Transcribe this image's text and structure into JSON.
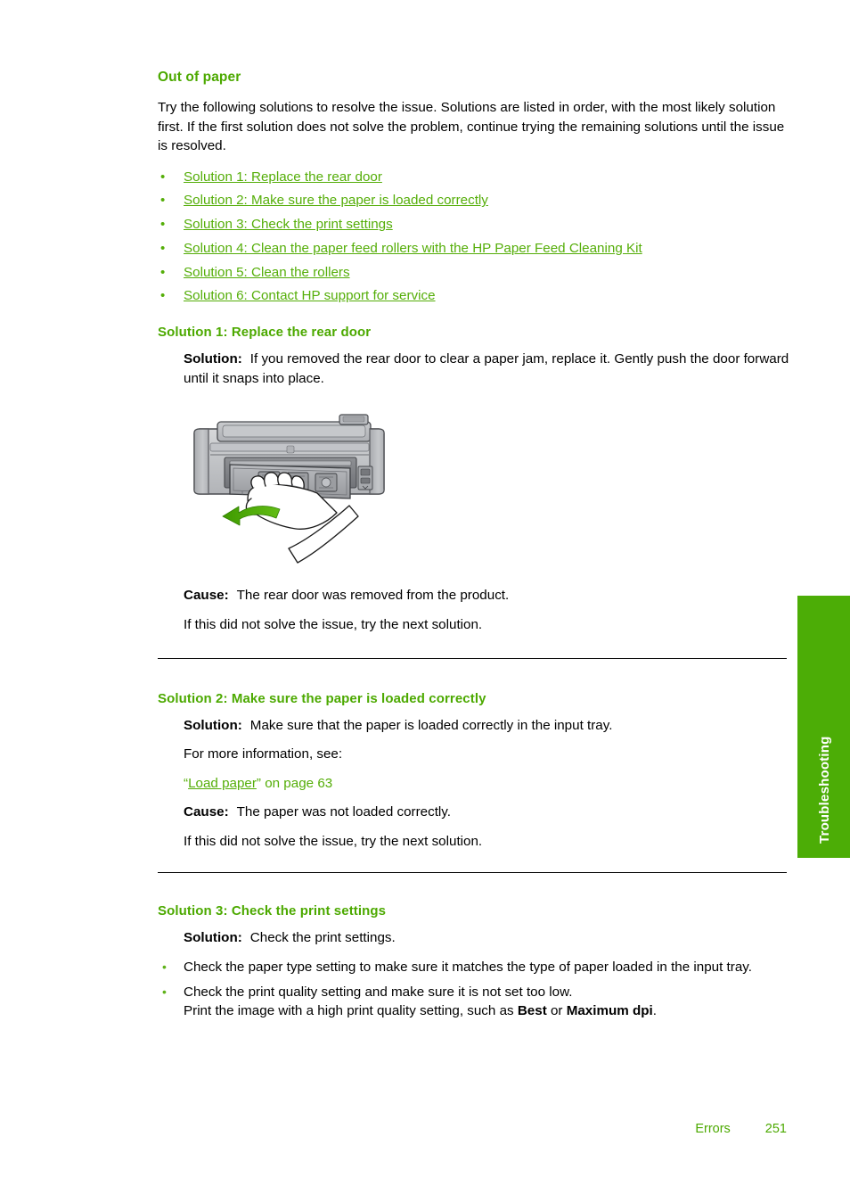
{
  "colors": {
    "heading_green": "#4CA900",
    "link_green": "#55AE09",
    "tab_green": "#4CAD06",
    "body_black": "#000000"
  },
  "topic": {
    "title": "Out of paper",
    "intro": "Try the following solutions to resolve the issue. Solutions are listed in order, with the most likely solution first. If the first solution does not solve the problem, continue trying the remaining solutions until the issue is resolved."
  },
  "solution_links": [
    {
      "bullet": "•",
      "label": "Solution 1: Replace the rear door"
    },
    {
      "bullet": "•",
      "label": "Solution 2: Make sure the paper is loaded correctly"
    },
    {
      "bullet": "•",
      "label": "Solution 3: Check the print settings"
    },
    {
      "bullet": "•",
      "label": "Solution 4: Clean the paper feed rollers with the HP Paper Feed Cleaning Kit"
    },
    {
      "bullet": "•",
      "label": "Solution 5: Clean the rollers"
    },
    {
      "bullet": "•",
      "label": "Solution 6: Contact HP support for service"
    }
  ],
  "labels": {
    "solution": "Solution:",
    "cause": "Cause:",
    "next_solution": "If this did not solve the issue, try the next solution.",
    "more_info": "For more information, see:"
  },
  "solution1": {
    "heading": "Solution 1: Replace the rear door",
    "solution_text": "If you removed the rear door to clear a paper jam, replace it. Gently push the door forward until it snaps into place.",
    "figure_name": "printer-rear-door-illustration",
    "cause_text": "The rear door was removed from the product.",
    "next": "If this did not solve the issue, try the next solution."
  },
  "solution2": {
    "heading": "Solution 2: Make sure the paper is loaded correctly",
    "solution_text": "Make sure that the paper is loaded correctly in the input tray.",
    "more_info": "For more information, see:",
    "xref_open_quote": "“",
    "xref_link": "Load paper",
    "xref_close": "” on page 63",
    "cause_text": "The paper was not loaded correctly.",
    "next": "If this did not solve the issue, try the next solution."
  },
  "solution3": {
    "heading": "Solution 3: Check the print settings",
    "solution_text": "Check the print settings.",
    "bullets": [
      {
        "bullet": "•",
        "text": "Check the paper type setting to make sure it matches the type of paper loaded in the input tray."
      },
      {
        "bullet": "•",
        "text": "Check the print quality setting and make sure it is not set too low.",
        "subtext_pre": "Print the image with a high print quality setting, such as ",
        "subtext_bold1": "Best",
        "subtext_mid": " or ",
        "subtext_bold2": "Maximum dpi",
        "subtext_post": "."
      }
    ]
  },
  "side_tab": {
    "label": "Troubleshooting"
  },
  "footer": {
    "section": "Errors",
    "page_number": "251"
  }
}
